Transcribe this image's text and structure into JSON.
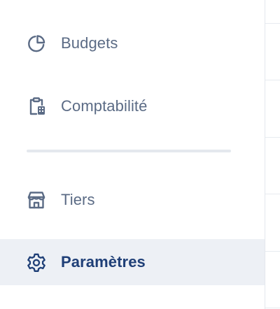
{
  "sidebar": {
    "items": [
      {
        "label": "Budgets",
        "icon": "pie-chart-icon",
        "active": false
      },
      {
        "label": "Comptabilité",
        "icon": "clipboard-calculator-icon",
        "active": false
      },
      {
        "label": "Tiers",
        "icon": "storefront-icon",
        "active": false
      },
      {
        "label": "Paramètres",
        "icon": "gear-icon",
        "active": true
      }
    ]
  },
  "colors": {
    "label_default": "#5b6b85",
    "label_active": "#1f3f77",
    "active_background": "#edf0f5",
    "divider": "#e4e8ee"
  }
}
